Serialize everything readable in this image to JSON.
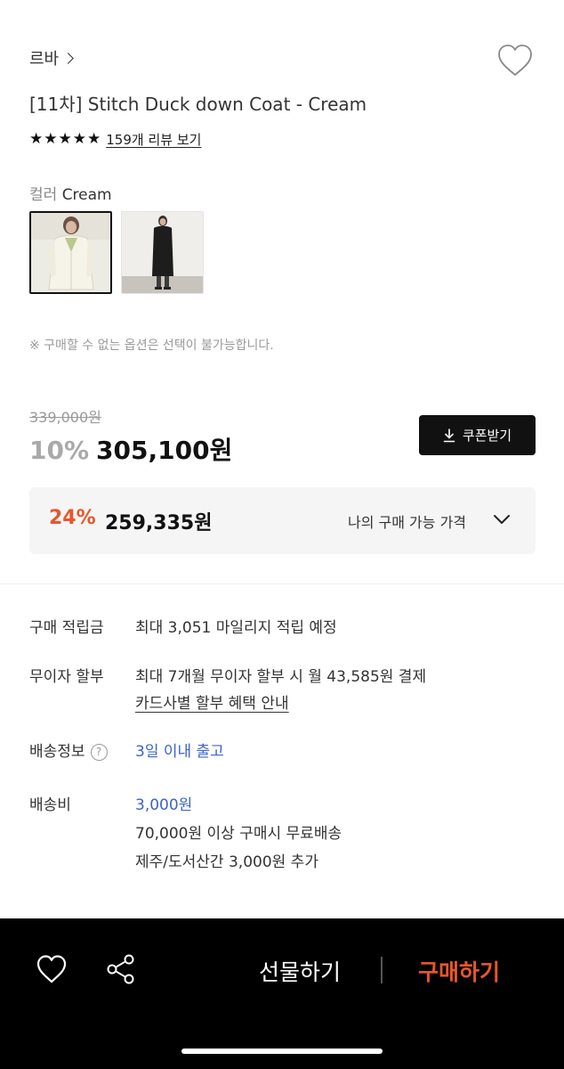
{
  "brand": {
    "name": "르바"
  },
  "product": {
    "title": "[11차] Stitch Duck down Coat - Cream",
    "rating_stars": 5,
    "reviews_link": "159개 리뷰 보기"
  },
  "color_option": {
    "label": "컬러",
    "selected": "Cream",
    "swatches": [
      "cream-coat-swatch",
      "black-coat-swatch"
    ]
  },
  "notice": "※ 구매할 수 없는 옵션은 선택이 불가능합니다.",
  "pricing": {
    "original": "339,000원",
    "discount_pct": "10%",
    "sale_price": "305,100원",
    "coupon_button": "쿠폰받기"
  },
  "my_price": {
    "discount_pct": "24%",
    "price": "259,335원",
    "label": "나의 구매 가능 가격"
  },
  "info": {
    "points_key": "구매 적립금",
    "points_val": "최대 3,051 마일리지 적립 예정",
    "installment_key": "무이자 할부",
    "installment_val": "최대 7개월 무이자 할부 시 월 43,585원 결제",
    "installment_link": "카드사별 할부 혜택 안내",
    "shipping_key": "배송정보",
    "shipping_help": "?",
    "shipping_val": "3일 이내 출고",
    "fee_key": "배송비",
    "fee_val": "3,000원",
    "fee_note1": "70,000원 이상 구매시 무료배송",
    "fee_note2": "제주/도서산간 3,000원 추가"
  },
  "bottom_bar": {
    "gift_button": "선물하기",
    "buy_button": "구매하기"
  },
  "colors": {
    "accent_orange": "#e8562b",
    "link_blue": "#3d63c9",
    "dark": "#111111"
  }
}
